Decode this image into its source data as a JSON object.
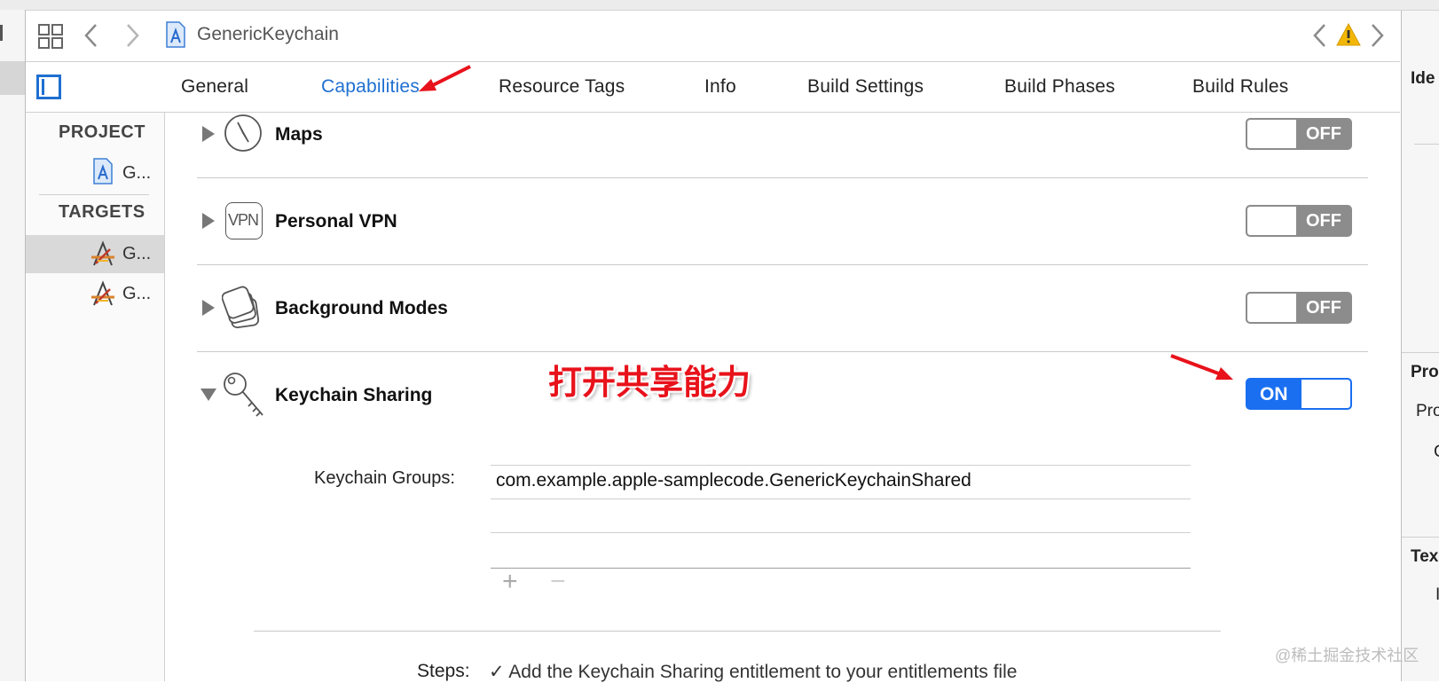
{
  "window": {
    "document_title": "GenericKeychain"
  },
  "tabs": [
    {
      "label": "General",
      "active": false
    },
    {
      "label": "Capabilities",
      "active": true
    },
    {
      "label": "Resource Tags",
      "active": false
    },
    {
      "label": "Info",
      "active": false
    },
    {
      "label": "Build Settings",
      "active": false
    },
    {
      "label": "Build Phases",
      "active": false
    },
    {
      "label": "Build Rules",
      "active": false
    }
  ],
  "sidebar": {
    "project_header": "PROJECT",
    "project_item": "G...",
    "targets_header": "TARGETS",
    "targets": [
      {
        "label": "G...",
        "selected": true
      },
      {
        "label": "G...",
        "selected": false
      }
    ]
  },
  "capabilities": [
    {
      "title": "Maps",
      "state": "OFF",
      "expanded": false,
      "icon": "compass-icon"
    },
    {
      "title": "Personal VPN",
      "state": "OFF",
      "expanded": false,
      "icon": "vpn-icon",
      "icon_text": "VPN"
    },
    {
      "title": "Background Modes",
      "state": "OFF",
      "expanded": false,
      "icon": "layers-icon"
    },
    {
      "title": "Keychain Sharing",
      "state": "ON",
      "expanded": true,
      "icon": "key-icon"
    }
  ],
  "keychain": {
    "groups_label": "Keychain Groups:",
    "groups": [
      "com.example.apple-samplecode.GenericKeychainShared"
    ],
    "add_symbol": "+",
    "remove_symbol": "−",
    "steps_label": "Steps:",
    "steps": [
      "✓ Add the Keychain Sharing entitlement to your entitlements file"
    ]
  },
  "annotation": {
    "text": "打开共享能力",
    "color": "#e8121b"
  },
  "inspector": {
    "labels": [
      "Ide",
      "Pro",
      "Pro",
      "C",
      "Tex",
      "I"
    ]
  },
  "watermark": "@稀土掘金技术社区",
  "colors": {
    "accent": "#1f6fd1",
    "toggle_on": "#1a6ff0",
    "toggle_off": "#8c8c8c",
    "warning": "#f2b705"
  }
}
